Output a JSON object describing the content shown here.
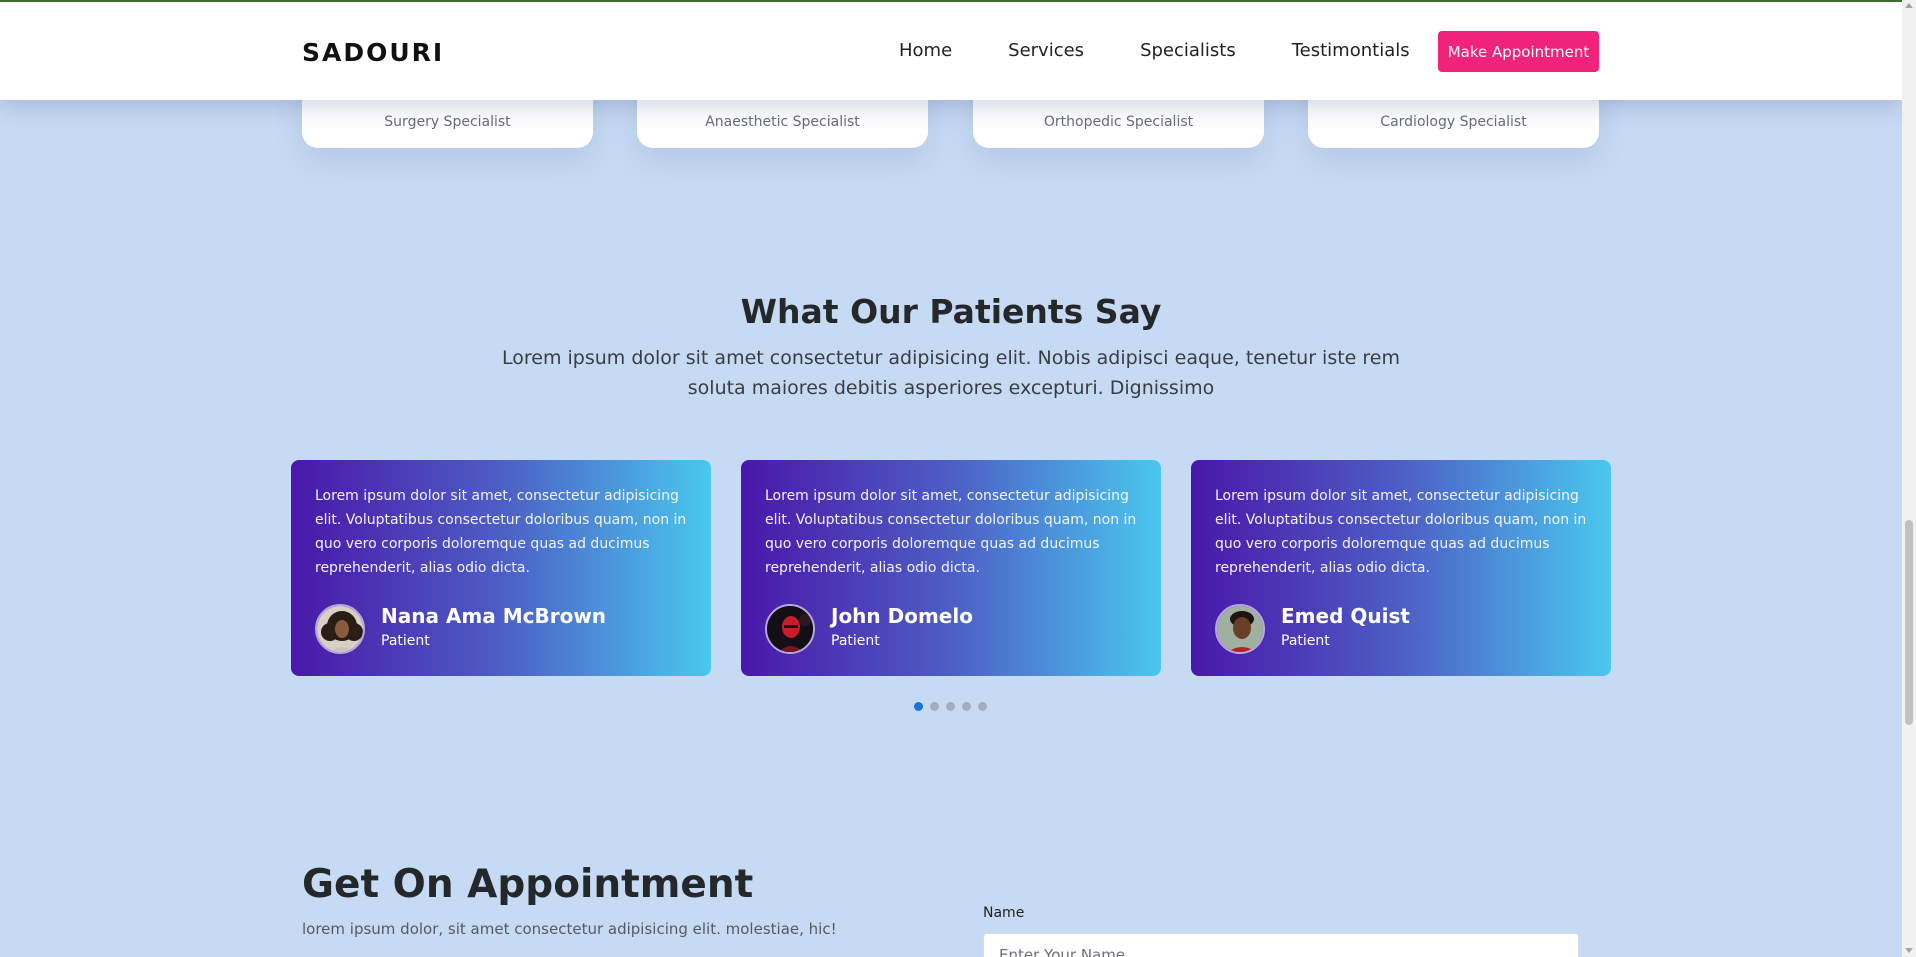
{
  "brand": "SADOURI",
  "nav": {
    "home": "Home",
    "services": "Services",
    "specialists": "Specialists",
    "testimonials": "Testimontials",
    "cta": "Make Appointment"
  },
  "specialist_cards": [
    {
      "role": "Surgery Specialist"
    },
    {
      "role": "Anaesthetic Specialist"
    },
    {
      "role": "Orthopedic Specialist"
    },
    {
      "role": "Cardiology Specialist"
    }
  ],
  "testimonials_section": {
    "title": "What Our Patients Say",
    "subtitle": "Lorem ipsum dolor sit amet consectetur adipisicing elit. Nobis adipisci eaque, tenetur iste rem soluta maiores debitis asperiores excepturi. Dignissimo",
    "items": [
      {
        "quote": "Lorem ipsum dolor sit amet, consectetur adipisicing elit. Voluptatibus consectetur doloribus quam, non in quo vero corporis doloremque quas ad ducimus reprehenderit, alias odio dicta.",
        "name": "Nana Ama McBrown",
        "role": "Patient"
      },
      {
        "quote": "Lorem ipsum dolor sit amet, consectetur adipisicing elit. Voluptatibus consectetur doloribus quam, non in quo vero corporis doloremque quas ad ducimus reprehenderit, alias odio dicta.",
        "name": "John Domelo",
        "role": "Patient"
      },
      {
        "quote": "Lorem ipsum dolor sit amet, consectetur adipisicing elit. Voluptatibus consectetur doloribus quam, non in quo vero corporis doloremque quas ad ducimus reprehenderit, alias odio dicta.",
        "name": "Emed Quist",
        "role": "Patient"
      }
    ],
    "carousel_pages": 5,
    "carousel_active_index": 0
  },
  "appointment": {
    "title": "Get On Appointment",
    "subtitle": "lorem ipsum dolor, sit amet consectetur adipisicing elit. molestiae, hic!",
    "name_label": "Name",
    "name_placeholder": "Enter Your Name"
  },
  "colors": {
    "page_background": "#c7daf4",
    "accent": "#f0237a",
    "card_gradient_start": "#4a17a9",
    "card_gradient_end": "#4ac8ee",
    "dot_active": "#1d6fd9"
  }
}
